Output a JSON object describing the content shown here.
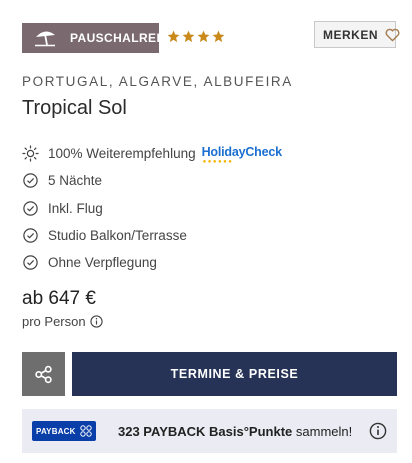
{
  "badge": {
    "label": "PAUSCHALREISE",
    "icon": "beach-umbrella-icon",
    "color": "#7a6a6f"
  },
  "rating": {
    "stars": 4,
    "max": 4,
    "color": "#c98a1b"
  },
  "merken": {
    "label": "MERKEN",
    "icon": "heart-icon"
  },
  "location": "PORTUGAL, ALGARVE, ALBUFEIRA",
  "hotel_name": "Tropical Sol",
  "features": [
    {
      "icon": "sun-icon",
      "label": "100% Weiterempfehlung"
    },
    {
      "icon": "check-circle-icon",
      "label": "5 Nächte"
    },
    {
      "icon": "check-circle-icon",
      "label": "Inkl. Flug"
    },
    {
      "icon": "check-circle-icon",
      "label": "Studio Balkon/Terrasse"
    },
    {
      "icon": "check-circle-icon",
      "label": "Ohne Verpflegung"
    }
  ],
  "holidaycheck": {
    "text": "HolidayCheck",
    "color": "#1b6fd0"
  },
  "price": {
    "label": "ab 647 €",
    "per": "pro Person"
  },
  "actions": {
    "share_icon": "share-icon",
    "cta_label": "TERMINE & PREISE",
    "cta_color": "#263356"
  },
  "payback": {
    "logo_text": "PAYBACK",
    "points": "323 PAYBACK Basis°Punkte",
    "suffix": "sammeln!"
  }
}
